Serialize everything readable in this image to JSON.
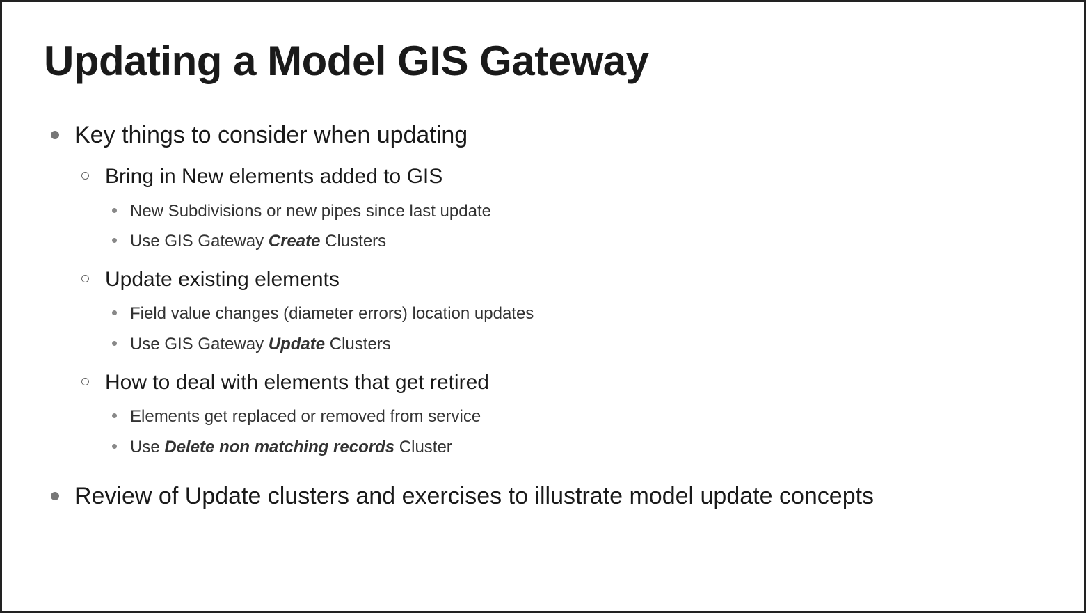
{
  "title": "Updating a Model GIS Gateway",
  "bullets": {
    "b1": {
      "text": "Key things to consider when updating",
      "sub": {
        "s1": {
          "text": "Bring in New elements added to GIS",
          "items": {
            "i1": "New Subdivisions or new pipes since last update",
            "i2_pre": "Use GIS Gateway ",
            "i2_em": "Create",
            "i2_post": " Clusters"
          }
        },
        "s2": {
          "text": "Update existing elements",
          "items": {
            "i1": "Field value changes (diameter errors) location updates",
            "i2_pre": "Use GIS Gateway ",
            "i2_em": "Update",
            "i2_post": " Clusters"
          }
        },
        "s3": {
          "text": "How to deal with elements that get retired",
          "items": {
            "i1": "Elements get replaced or removed from service",
            "i2_pre": "Use ",
            "i2_em": "Delete non matching records",
            "i2_post": " Cluster"
          }
        }
      }
    },
    "b2": {
      "text": "Review of Update clusters and exercises to illustrate model update concepts"
    }
  }
}
